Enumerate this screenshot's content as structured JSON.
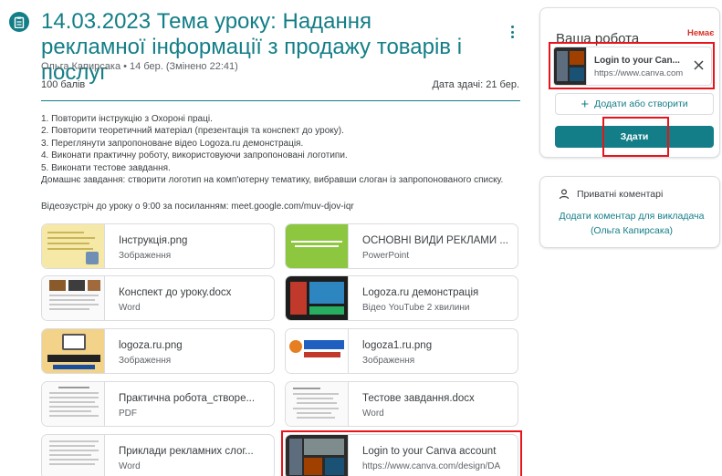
{
  "assignment": {
    "title": "14.03.2023 Тема уроку: Надання рекламної інформації з продажу товарів і послуг",
    "meta": "Ольга Капирсака • 14 бер. (Змінено 22:41)",
    "points": "100 балів",
    "due": "Дата здачі: 21 бер.",
    "instructions": [
      "1. Повторити інструкцію з Охороні праці.",
      "2. Повторити теоретичний матеріал (презентація та конспект до уроку).",
      "3. Переглянути запропоноване відео Logoza.ru демонстрація.",
      "4. Виконати практичну роботу, використовуючи запропоновані логотипи.",
      "5. Виконати тестове завдання.",
      "Домашнє завдання: створити логотип на комп'ютерну тематику, вибравши слоган із запропонованого списку."
    ],
    "meeting": "Відеозустріч до уроку о 9:00 за посиланням: meet.google.com/muv-djov-iqr"
  },
  "attachments": [
    {
      "name": "Інструкція.png",
      "type": "Зображення",
      "thumb": "yellow-doc"
    },
    {
      "name": "ОСНОВНІ ВИДИ РЕКЛАМИ ...",
      "type": "PowerPoint",
      "thumb": "green-slide"
    },
    {
      "name": "Конспект до уроку.docx",
      "type": "Word",
      "thumb": "doc-photos"
    },
    {
      "name": "Logoza.ru демонстрація",
      "type": "Відео YouTube   2 хвилини",
      "thumb": "video"
    },
    {
      "name": "logoza.ru.png",
      "type": "Зображення",
      "thumb": "internet"
    },
    {
      "name": "logoza1.ru.png",
      "type": "Зображення",
      "thumb": "merezha"
    },
    {
      "name": "Практична робота_створе...",
      "type": "PDF",
      "thumb": "text-doc"
    },
    {
      "name": "Тестове завдання.docx",
      "type": "Word",
      "thumb": "test-doc"
    },
    {
      "name": "Приклади рекламних слог...",
      "type": "Word",
      "thumb": "text-doc"
    },
    {
      "name": "Login to your Canva account",
      "type": "https://www.canva.com/design/DA",
      "thumb": "canva"
    }
  ],
  "your_work": {
    "title": "Ваша робота",
    "status": "Немає",
    "link_title": "Login to your Can...",
    "link_url": "https://www.canva.com",
    "add_label": "Додати або створити",
    "submit_label": "Здати"
  },
  "private_comments": {
    "title": "Приватні коментарі",
    "add_link": "Додати коментар для викладача (Ольга Капирсака)"
  },
  "colors": {
    "accent": "#137e87",
    "highlight": "#e8141a",
    "status_missing": "#d93025"
  }
}
